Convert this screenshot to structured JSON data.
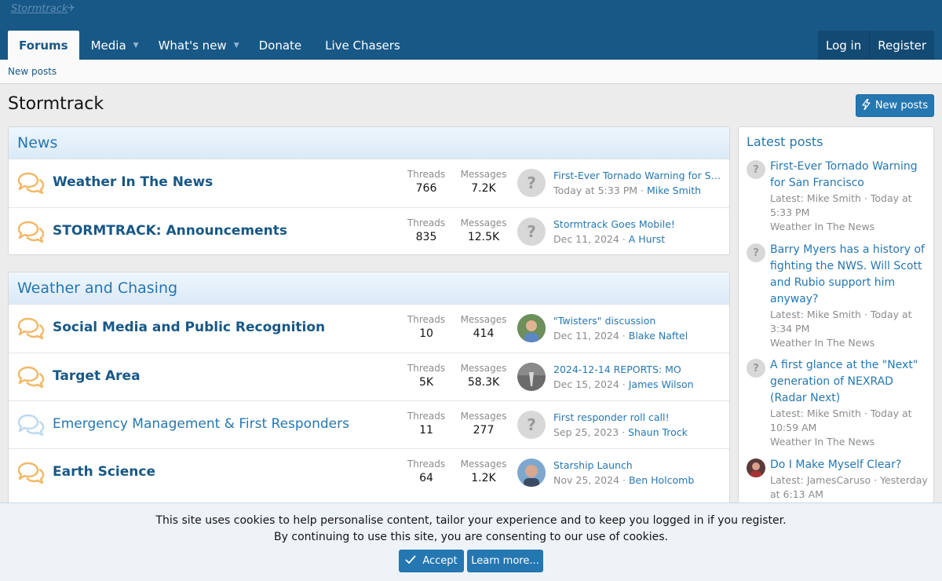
{
  "site": {
    "logo_text": "Stormtrack"
  },
  "nav": {
    "tabs": [
      {
        "label": "Forums"
      },
      {
        "label": "Media"
      },
      {
        "label": "What's new"
      },
      {
        "label": "Donate"
      },
      {
        "label": "Live Chasers"
      }
    ],
    "login": "Log in",
    "register": "Register"
  },
  "subnav": {
    "new_posts": "New posts"
  },
  "page": {
    "title": "Stormtrack",
    "new_posts_button": "New posts"
  },
  "categories": [
    {
      "title": "News",
      "nodes": [
        {
          "title": "Weather In The News",
          "threads_label": "Threads",
          "threads": "766",
          "messages_label": "Messages",
          "messages": "7.2K",
          "last_title": "First-Ever Tornado Warning for San …",
          "last_date": "Today at 5:33 PM",
          "last_user": "Mike Smith"
        },
        {
          "title": "STORMTRACK: Announcements",
          "threads_label": "Threads",
          "threads": "835",
          "messages_label": "Messages",
          "messages": "12.5K",
          "last_title": "Stormtrack Goes Mobile!",
          "last_date": "Dec 11, 2024",
          "last_user": "A Hurst"
        }
      ]
    },
    {
      "title": "Weather and Chasing",
      "nodes": [
        {
          "title": "Social Media and Public Recognition",
          "threads_label": "Threads",
          "threads": "10",
          "messages_label": "Messages",
          "messages": "414",
          "last_title": "\"Twisters\" discussion",
          "last_date": "Dec 11, 2024",
          "last_user": "Blake Naftel"
        },
        {
          "title": "Target Area",
          "threads_label": "Threads",
          "threads": "5K",
          "messages_label": "Messages",
          "messages": "58.3K",
          "last_title": "2024-12-14 REPORTS: MO",
          "last_date": "Dec 15, 2024",
          "last_user": "James Wilson"
        },
        {
          "title": "Emergency Management & First Responders",
          "threads_label": "Threads",
          "threads": "11",
          "messages_label": "Messages",
          "messages": "277",
          "last_title": "First responder roll call!",
          "last_date": "Sep 25, 2023",
          "last_user": "Shaun Trock"
        },
        {
          "title": "Earth Science",
          "threads_label": "Threads",
          "threads": "64",
          "messages_label": "Messages",
          "messages": "1.2K",
          "last_title": "Starship Launch",
          "last_date": "Nov 25, 2024",
          "last_user": "Ben Holcomb"
        }
      ]
    }
  ],
  "sidebar": {
    "title": "Latest posts",
    "items": [
      {
        "title": "First-Ever Tornado Warning for San Francisco",
        "meta": "Latest: Mike Smith · Today at 5:33 PM",
        "forum": "Weather In The News"
      },
      {
        "title": "Barry Myers has a history of fighting the NWS. Will Scott and Rubio support him anyway?",
        "meta": "Latest: Mike Smith · Today at 3:34 PM",
        "forum": "Weather In The News"
      },
      {
        "title": "A first glance at the \"Next\" generation of NEXRAD (Radar Next)",
        "meta": "Latest: Mike Smith · Today at 10:59 AM",
        "forum": "Weather In The News"
      },
      {
        "title": "Do I Make Myself Clear?",
        "meta": "Latest: JamesCaruso · Yesterday at 6:13 AM",
        "forum": ""
      }
    ]
  },
  "cookie": {
    "line1": "This site uses cookies to help personalise content, tailor your experience and to keep you logged in if you register.",
    "line2": "By continuing to use this site, you are consenting to our use of cookies.",
    "accept": "Accept",
    "learn_more": "Learn more..."
  },
  "colors": {
    "header": "#185886",
    "accent": "#2577b1",
    "unread_icon": "#f1b867",
    "read_icon": "#bcd9ef"
  }
}
